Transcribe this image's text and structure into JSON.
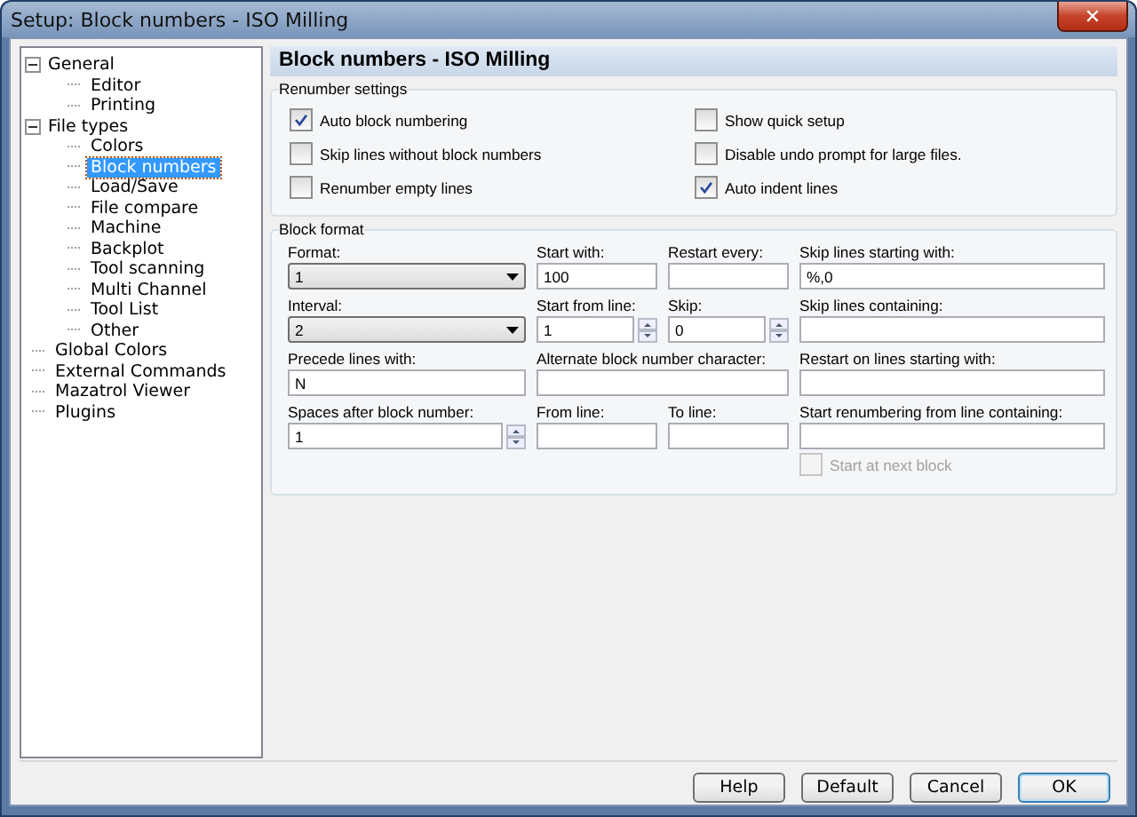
{
  "window": {
    "title": "Setup: Block numbers - ISO Milling",
    "close": "✕"
  },
  "tree": [
    {
      "label": "General",
      "expanded": true,
      "selected": false,
      "children": [
        {
          "label": "Editor",
          "selected": false
        },
        {
          "label": "Printing",
          "selected": false
        }
      ]
    },
    {
      "label": "File types",
      "expanded": true,
      "selected": false,
      "children": [
        {
          "label": "Colors",
          "selected": false
        },
        {
          "label": "Block numbers",
          "selected": true
        },
        {
          "label": "Load/Save",
          "selected": false
        },
        {
          "label": "File compare",
          "selected": false
        },
        {
          "label": "Machine",
          "selected": false
        },
        {
          "label": "Backplot",
          "selected": false
        },
        {
          "label": "Tool scanning",
          "selected": false
        },
        {
          "label": "Multi Channel",
          "selected": false
        },
        {
          "label": "Tool List",
          "selected": false
        },
        {
          "label": "Other",
          "selected": false
        }
      ]
    },
    {
      "label": "Global Colors",
      "selected": false
    },
    {
      "label": "External Commands",
      "selected": false
    },
    {
      "label": "Mazatrol Viewer",
      "selected": false
    },
    {
      "label": "Plugins",
      "selected": false
    }
  ],
  "header": "Block numbers - ISO Milling",
  "renumber_settings": {
    "title": "Renumber settings",
    "options": [
      {
        "label": "Auto block numbering",
        "checked": true
      },
      {
        "label": "Show quick setup",
        "checked": false
      },
      {
        "label": "Skip lines without block numbers",
        "checked": false
      },
      {
        "label": "Disable undo prompt for large files.",
        "checked": false
      },
      {
        "label": "Renumber empty lines",
        "checked": false
      },
      {
        "label": "Auto indent lines",
        "checked": true
      }
    ]
  },
  "block_format": {
    "title": "Block format",
    "fields": [
      {
        "label": "Format:",
        "kind": "select",
        "value": "1"
      },
      {
        "label": "Start with:",
        "kind": "text",
        "value": "100"
      },
      {
        "label": "Restart every:",
        "kind": "text"
      },
      {
        "label": "Skip lines starting with:",
        "kind": "text",
        "value": "%,0"
      },
      {
        "label": "Interval:",
        "kind": "select",
        "value": "2"
      },
      {
        "label": "Start from line:",
        "kind": "spin",
        "value": "1"
      },
      {
        "label": "Skip:",
        "kind": "spin",
        "value": "0"
      },
      {
        "label": "Skip lines containing:",
        "kind": "text"
      },
      {
        "label": "Precede lines with:",
        "kind": "text",
        "value": "N"
      },
      {
        "label": "Alternate block number character:",
        "kind": "wide"
      },
      {
        "label": "Restart on lines starting with:",
        "kind": "text"
      },
      {
        "label": "Spaces after block number:",
        "kind": "spin",
        "value": "1"
      },
      {
        "label": "From line:",
        "kind": "text"
      },
      {
        "label": "To line:",
        "kind": "text"
      },
      {
        "label": "Start renumbering from line containing:",
        "kind": "text"
      }
    ],
    "start_at_next_block": {
      "label": "Start at next block",
      "checked": false,
      "disabled": true
    }
  },
  "buttons": [
    {
      "label": "Help",
      "default": false
    },
    {
      "label": "Default",
      "default": false
    },
    {
      "label": "Cancel",
      "default": false
    },
    {
      "label": "OK",
      "default": true
    }
  ]
}
